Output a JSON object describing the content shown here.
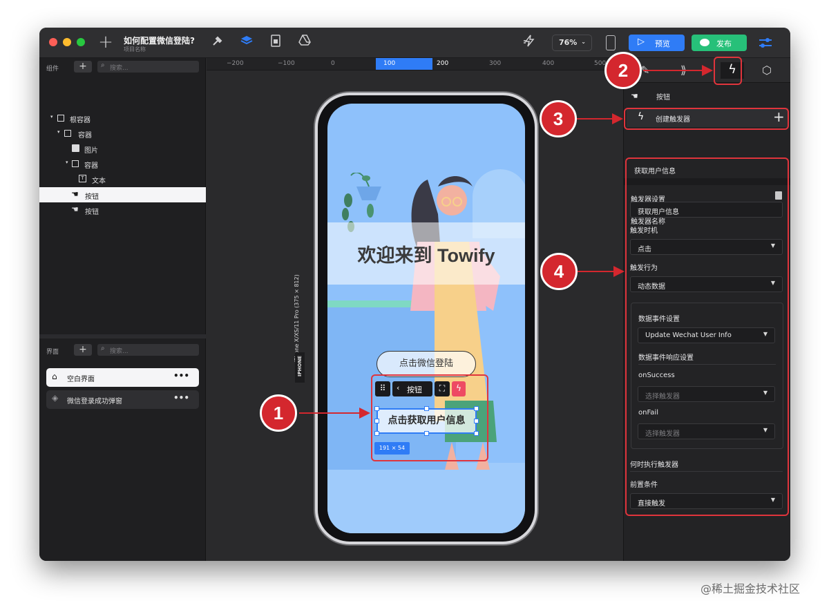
{
  "window": {
    "title": "如何配置微信登陆?",
    "subtitle": "项目名称",
    "zoom": "76%",
    "preview_label": "预览",
    "publish_label": "发布"
  },
  "components_panel": {
    "header": "组件",
    "search_placeholder": "搜索...",
    "tree": [
      {
        "label": "根容器",
        "icon": "square-icon"
      },
      {
        "label": "容器",
        "icon": "square-icon"
      },
      {
        "label": "图片",
        "icon": "image-icon"
      },
      {
        "label": "容器",
        "icon": "square-icon"
      },
      {
        "label": "文本",
        "icon": "text-icon"
      },
      {
        "label": "按钮",
        "icon": "hand-icon",
        "selected": true
      },
      {
        "label": "按钮",
        "icon": "hand-icon"
      }
    ]
  },
  "pages_panel": {
    "header": "界面",
    "search_placeholder": "搜索...",
    "pages": [
      {
        "label": "空白界面",
        "icon": "home-icon",
        "selected": true
      },
      {
        "label": "微信登录成功弹窗",
        "icon": "layers-icon"
      }
    ]
  },
  "ruler": {
    "ticks": [
      "−200",
      "−100",
      "0",
      "100",
      "200",
      "300",
      "400",
      "500"
    ]
  },
  "canvas": {
    "device_label": "iPhone X/XS/11 Pro (375 × 812)",
    "device_tag": "IPHONE",
    "hero_text": "欢迎来到 Towify",
    "ghost_button_text": "点击微信登陆",
    "button_text": "点击获取用户信息",
    "toolbar_label": "按钮",
    "size_badge": "191 × 54"
  },
  "right_panel": {
    "component_title": "按钮",
    "create_trigger": "创建触发器",
    "trigger_item": "获取用户信息",
    "trigger_settings": "触发器设置",
    "trigger_name_label": "触发器名称",
    "trigger_name_value": "获取用户信息",
    "trigger_timing_label": "触发时机",
    "trigger_timing_value": "点击",
    "trigger_action_label": "触发行为",
    "trigger_action_value": "动态数据",
    "data_event_label": "数据事件设置",
    "data_event_value": "Update Wechat User Info",
    "data_response_label": "数据事件响应设置",
    "on_success_label": "onSuccess",
    "on_success_placeholder": "选择触发器",
    "on_fail_label": "onFail",
    "on_fail_placeholder": "选择触发器",
    "when_label": "何时执行触发器",
    "precondition_label": "前置条件",
    "precondition_value": "直接触发"
  },
  "callouts": [
    "1",
    "2",
    "3",
    "4"
  ],
  "watermark": "@稀土掘金技术社区",
  "colors": {
    "accent_blue": "#2f7cf6",
    "publish_green": "#27c079",
    "callout_red": "#d4272e"
  }
}
